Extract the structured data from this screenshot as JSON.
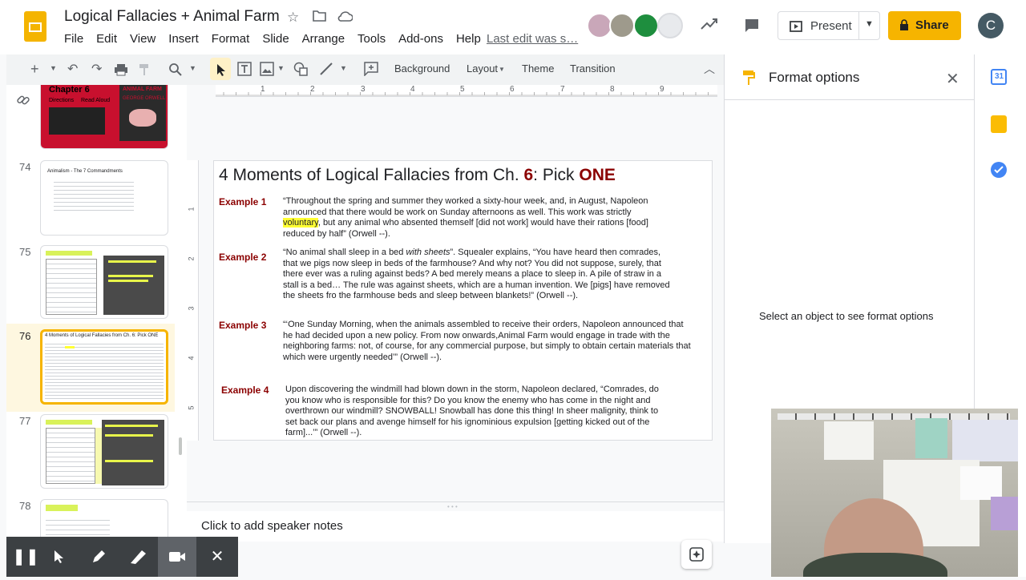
{
  "header": {
    "doc_title": "Logical Fallacies + Animal Farm",
    "menu": [
      "File",
      "Edit",
      "View",
      "Insert",
      "Format",
      "Slide",
      "Arrange",
      "Tools",
      "Add-ons",
      "Help"
    ],
    "last_edit": "Last edit was s…",
    "present_label": "Present",
    "share_label": "Share",
    "user_initial": "C"
  },
  "toolbar": {
    "background_label": "Background",
    "layout_label": "Layout",
    "theme_label": "Theme",
    "transition_label": "Transition",
    "ruler_ticks": [
      "1",
      "2",
      "3",
      "4",
      "5",
      "6",
      "7",
      "8",
      "9"
    ],
    "vruler_ticks": [
      "1",
      "2",
      "3",
      "4",
      "5"
    ]
  },
  "filmstrip": {
    "slides": [
      {
        "num": "",
        "title": "Chapter 6",
        "sub1": "Directions",
        "sub2": "Read Aloud",
        "book": "ANIMAL FARM",
        "author": "GEORGE ORWELL"
      },
      {
        "num": "74",
        "title": "Animalism - The 7 Commandments"
      },
      {
        "num": "75",
        "title": "Propaganda in Animal Farm"
      },
      {
        "num": "76",
        "title": "4 Moments of Logical Fallacies from Ch. 6: Pick ONE"
      },
      {
        "num": "77",
        "title": "Propaganda in Animal Farm"
      },
      {
        "num": "78",
        "title": "In Sensology..."
      }
    ]
  },
  "slide": {
    "title_prefix": "4 Moments of Logical Fallacies from Ch. ",
    "title_num": "6",
    "title_mid": ": Pick ",
    "title_end": "ONE",
    "examples": [
      {
        "label": "Example 1",
        "line1": "“Throughout the spring and summer they worked a sixty-hour week, and, in August, Napoleon",
        "line2": "announced that there would be work on Sunday afternoons as well.  This work was strictly",
        "highlight": "voluntary",
        "line3_rest": ", but any animal who absented themself [did not work] would have their rations [food]",
        "line4": "reduced by half” (Orwell --)."
      },
      {
        "label": "Example 2",
        "line1_a": "“No animal shall sleep in a bed ",
        "line1_em": "with sheets",
        "line1_b": "”.  Squealer explains, “You have heard then comrades,",
        "line2": "that we pigs now sleep in beds of the farmhouse?  And why not?  You did not suppose, surely, that",
        "line3": "there ever was a ruling against beds?   A bed merely means a place to sleep in.  A pile of straw in a",
        "line4": "stall is a bed… The rule was against sheets, which are a human invention.  We [pigs] have removed",
        "line5": "the sheets  fro the farmhouse beds and sleep between blankets!”  (Orwell --)."
      },
      {
        "label": "Example 3",
        "line1": "“‘One Sunday Morning, when the animals assembled to receive their orders, Napoleon announced that",
        "line2": "he had decided upon a new policy.  From now onwards,Animal Farm would engage in trade with the",
        "line3": "neighboring farms: not, of course, for any commercial purpose, but simply to obtain certain materials that",
        "line4": "which were urgently needed’” (Orwell --)."
      },
      {
        "label": "Example 4",
        "line1": "Upon discovering the windmill had blown down in the storm, Napoleon declared, “Comrades, do",
        "line2": "you know who is responsible for this?  Do you know the enemy who has come in the night and",
        "line3": "overthrown our windmill?  SNOWBALL!  Snowball has done this thing!  In sheer malignity, think to",
        "line4": "set back our plans and avenge himself for his ignominious expulsion [getting kicked out of the",
        "line5": "farm]...’” (Orwell --)."
      }
    ]
  },
  "notes": {
    "placeholder": "Click to add speaker notes"
  },
  "format_panel": {
    "title": "Format options",
    "empty_message": "Select an object to see format options"
  },
  "colors": {
    "accent": "#8b0000",
    "share": "#f6b400",
    "highlight": "#ffff33"
  }
}
